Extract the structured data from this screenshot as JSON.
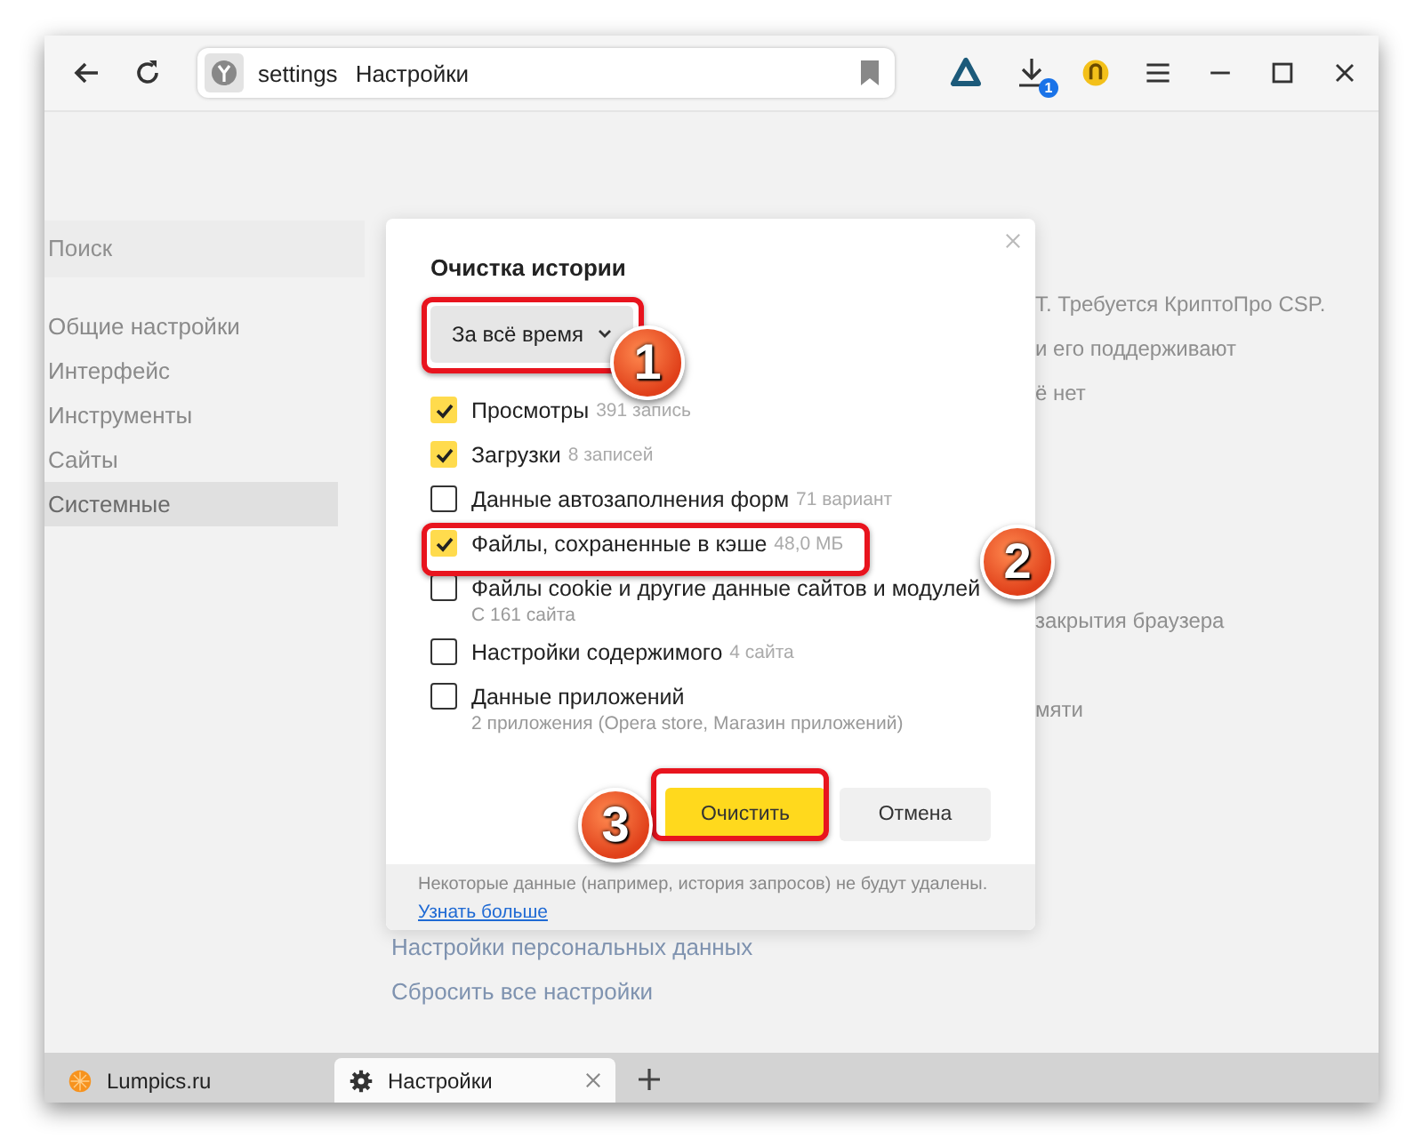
{
  "toolbar": {
    "address": {
      "site": "settings",
      "title": "Настройки"
    },
    "download_badge": "1"
  },
  "sidebar": {
    "search": {
      "placeholder": "Поиск"
    },
    "items": [
      {
        "label": "Общие настройки",
        "selected": false
      },
      {
        "label": "Интерфейс",
        "selected": false
      },
      {
        "label": "Инструменты",
        "selected": false
      },
      {
        "label": "Сайты",
        "selected": false
      },
      {
        "label": "Системные",
        "selected": true
      }
    ]
  },
  "background_text": [
    [
      "Т. Требуется КриптоПро CSP.",
      "и его поддерживают",
      "ё нет"
    ],
    [
      "закрытия браузера"
    ],
    [
      "мяти"
    ]
  ],
  "background_links": [
    "Настройки персональных данных",
    "Сбросить все настройки"
  ],
  "dialog": {
    "title": "Очистка истории",
    "period": "За всё время",
    "options": [
      {
        "label": "Просмотры",
        "note": "391 запись",
        "checked": true
      },
      {
        "label": "Загрузки",
        "note": "8 записей",
        "checked": true
      },
      {
        "label": "Данные автозаполнения форм",
        "note": "71 вариант",
        "checked": false
      },
      {
        "label": "Файлы, сохраненные в кэше",
        "note": "48,0 МБ",
        "checked": true
      },
      {
        "label": "Файлы cookie и другие данные сайтов и модулей",
        "sub": "С 161 сайта",
        "checked": false
      },
      {
        "label": "Настройки содержимого",
        "note": "4 сайта",
        "checked": false
      },
      {
        "label": "Данные приложений",
        "sub": "2 приложения (Opera store, Магазин приложений)",
        "checked": false
      }
    ],
    "buttons": [
      {
        "label": "Очистить",
        "kind": "primary"
      },
      {
        "label": "Отмена",
        "kind": "secondary"
      }
    ],
    "footer": {
      "text": "Некоторые данные (например, история запросов) не будут удалены.",
      "link": "Узнать больше"
    }
  },
  "annotations": [
    {
      "label": "1"
    },
    {
      "label": "2"
    },
    {
      "label": "3"
    }
  ],
  "tabs": [
    {
      "label": "Lumpics.ru",
      "kind": "site",
      "selected": false
    },
    {
      "label": "Настройки",
      "kind": "settings",
      "selected": true
    }
  ]
}
